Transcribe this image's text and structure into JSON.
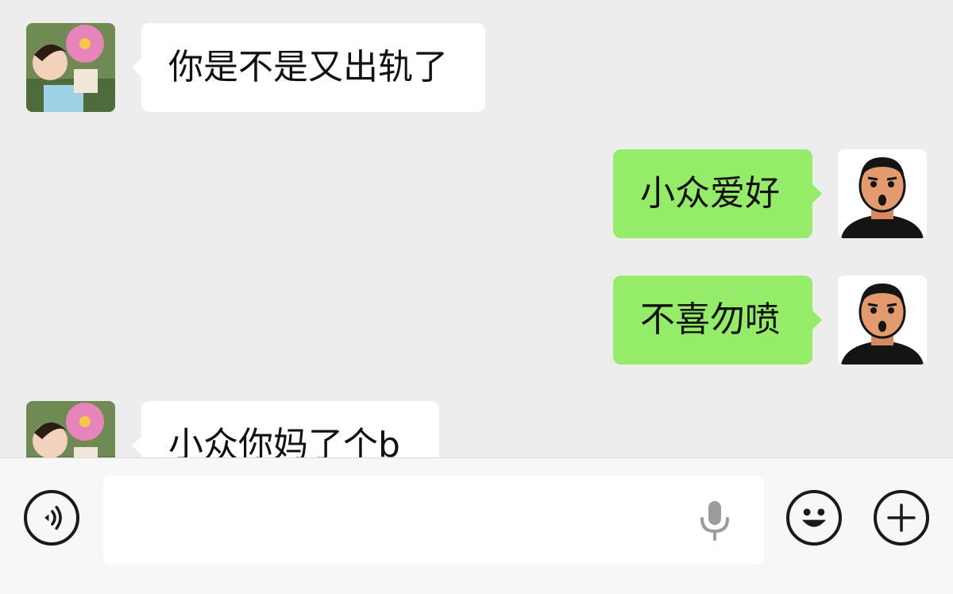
{
  "messages": [
    {
      "side": "left",
      "text": "你是不是又出轨了",
      "avatar_icon": "girl-flower-avatar"
    },
    {
      "side": "right",
      "text": "小众爱好",
      "avatar_icon": "cartoon-man-avatar"
    },
    {
      "side": "right",
      "text": "不喜勿喷",
      "avatar_icon": "cartoon-man-avatar"
    },
    {
      "side": "left",
      "text": "小众你妈了个b",
      "avatar_icon": "girl-flower-avatar"
    }
  ],
  "input_bar": {
    "voice_icon": "voice-icon",
    "mic_icon": "microphone-icon",
    "emoji_icon": "emoji-icon",
    "plus_icon": "plus-icon"
  },
  "colors": {
    "chat_background": "#ededed",
    "incoming_bubble": "#ffffff",
    "outgoing_bubble": "#95ec69"
  }
}
